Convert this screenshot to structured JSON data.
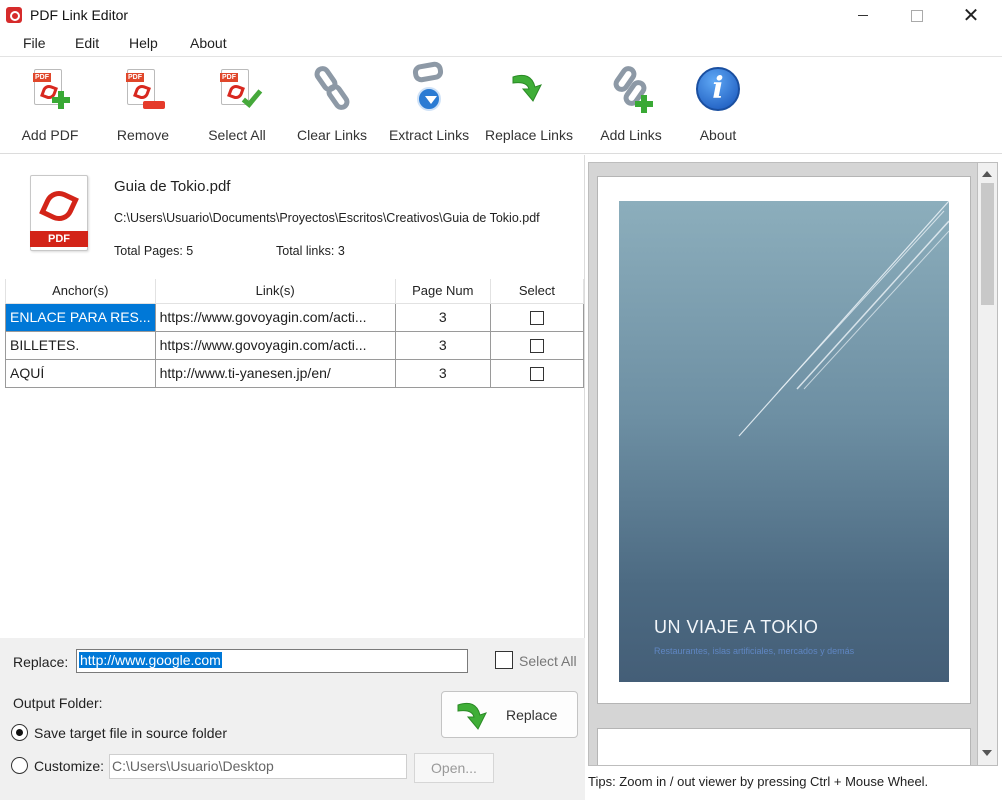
{
  "window": {
    "title": "PDF Link Editor",
    "close_glyph": "✕"
  },
  "menu": [
    "File",
    "Edit",
    "Help",
    "About"
  ],
  "toolbar": [
    {
      "label": "Add PDF",
      "icon": "add-pdf-icon"
    },
    {
      "label": "Remove",
      "icon": "remove-pdf-icon"
    },
    {
      "label": "Select All",
      "icon": "select-all-icon"
    },
    {
      "label": "Clear Links",
      "icon": "clear-links-icon"
    },
    {
      "label": "Extract Links",
      "icon": "extract-links-icon"
    },
    {
      "label": "Replace Links",
      "icon": "replace-links-icon"
    },
    {
      "label": "Add Links",
      "icon": "add-links-icon"
    },
    {
      "label": "About",
      "icon": "info-icon"
    }
  ],
  "file": {
    "icon_label": "PDF",
    "name": "Guia de Tokio.pdf",
    "path": "C:\\Users\\Usuario\\Documents\\Proyectos\\Escritos\\Creativos\\Guia de Tokio.pdf",
    "total_pages": "Total Pages: 5",
    "total_links": "Total links: 3"
  },
  "table": {
    "headers": [
      "Anchor(s)",
      "Link(s)",
      "Page Num",
      "Select"
    ],
    "rows": [
      {
        "anchor": "ENLACE PARA RES...",
        "link": "https://www.govoyagin.com/acti...",
        "page": "3",
        "selected": false
      },
      {
        "anchor": "BILLETES.",
        "link": "https://www.govoyagin.com/acti...",
        "page": "3",
        "selected": false
      },
      {
        "anchor": "AQUÍ",
        "link": "http://www.ti-yanesen.jp/en/",
        "page": "3",
        "selected": false
      }
    ]
  },
  "replace": {
    "label": "Replace:",
    "value": "http://www.google.com",
    "select_all_label": "Select All",
    "select_all_checked": false
  },
  "output": {
    "label": "Output Folder:",
    "option_source": "Save target file in source folder",
    "option_custom": "Customize:",
    "selected": "source",
    "custom_path": "C:\\Users\\Usuario\\Desktop",
    "open_label": "Open...",
    "replace_button": "Replace"
  },
  "preview": {
    "cover_title": "UN VIAJE A TOKIO",
    "cover_subtitle": "Restaurantes, islas artificiales, mercados y demás"
  },
  "tips": "Tips: Zoom in / out viewer by pressing Ctrl + Mouse Wheel.",
  "colors": {
    "selection": "#0078d7",
    "accent_red": "#d32418",
    "accent_green": "#39a935"
  }
}
